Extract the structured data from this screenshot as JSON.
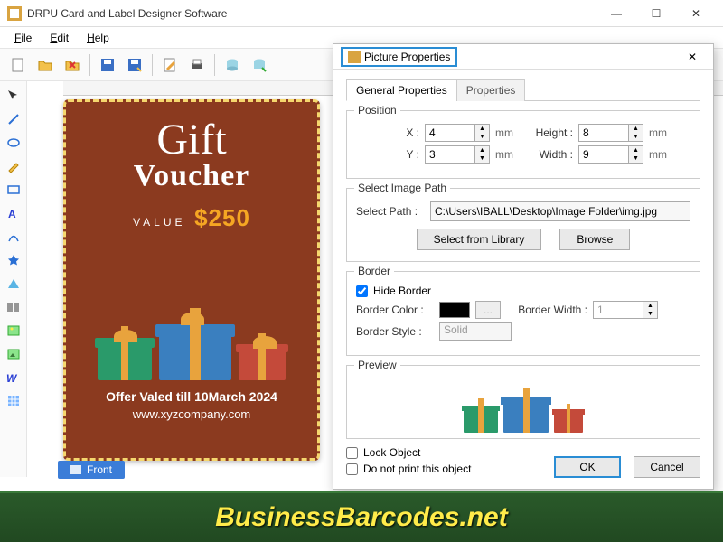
{
  "window": {
    "title": "DRPU Card and Label Designer Software",
    "min_label": "—",
    "max_label": "☐",
    "close_label": "✕"
  },
  "menu": {
    "file": "File",
    "edit": "Edit",
    "help": "Help"
  },
  "card": {
    "gift": "Gift",
    "voucher": "Voucher",
    "value_label": "VALUE",
    "value_amount": "$250",
    "offer": "Offer Valed till 10March 2024",
    "url": "www.xyzcompany.com"
  },
  "front_tab": "Front",
  "dialog": {
    "title": "Picture Properties",
    "close": "✕",
    "tabs": {
      "general": "General Properties",
      "properties": "Properties"
    },
    "position": {
      "legend": "Position",
      "x_label": "X :",
      "x_value": "4",
      "y_label": "Y :",
      "y_value": "3",
      "h_label": "Height :",
      "h_value": "8",
      "w_label": "Width :",
      "w_value": "9",
      "unit": "mm"
    },
    "imgpath": {
      "legend": "Select Image Path",
      "label": "Select Path :",
      "value": "C:\\Users\\IBALL\\Desktop\\Image Folder\\img.jpg",
      "lib_btn": "Select from Library",
      "browse_btn": "Browse"
    },
    "border": {
      "legend": "Border",
      "hide": "Hide Border",
      "color_label": "Border Color :",
      "ellipsis": "...",
      "width_label": "Border Width :",
      "width_value": "1",
      "style_label": "Border Style :",
      "style_value": "Solid"
    },
    "preview": {
      "legend": "Preview"
    },
    "lock": "Lock Object",
    "noprint": "Do not print this object",
    "ok": "OK",
    "cancel": "Cancel"
  },
  "brand": "BusinessBarcodes.net"
}
